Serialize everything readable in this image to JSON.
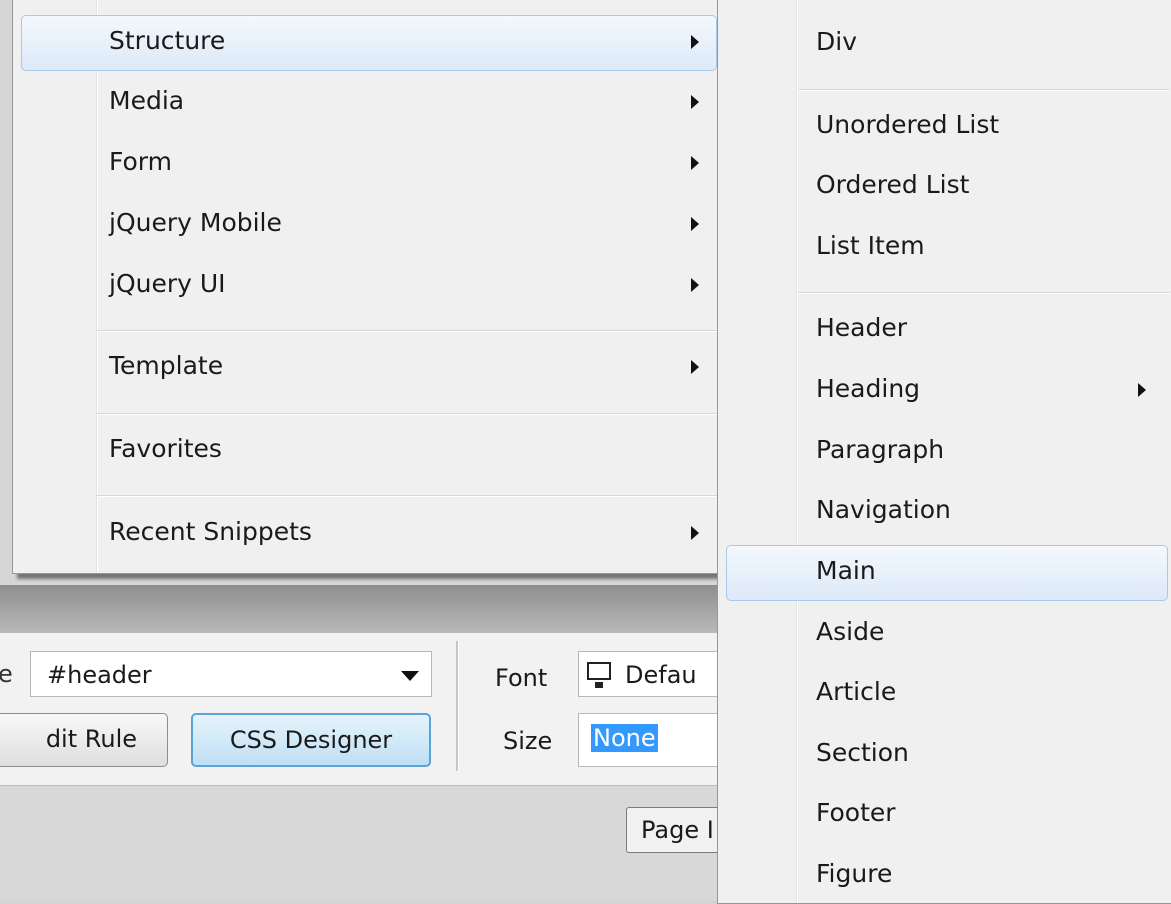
{
  "menu_primary": {
    "items": [
      {
        "label": "Structure",
        "submenu": true,
        "highlighted": true
      },
      {
        "label": "Media",
        "submenu": true
      },
      {
        "label": "Form",
        "submenu": true
      },
      {
        "label": "jQuery Mobile",
        "submenu": true
      },
      {
        "label": "jQuery UI",
        "submenu": true
      },
      {
        "label": "Template",
        "submenu": true
      },
      {
        "label": "Favorites",
        "submenu": false
      },
      {
        "label": "Recent Snippets",
        "submenu": true
      }
    ]
  },
  "menu_structure": {
    "items": [
      {
        "label": "Div"
      },
      {
        "label": "Unordered List"
      },
      {
        "label": "Ordered List"
      },
      {
        "label": "List Item"
      },
      {
        "label": "Header"
      },
      {
        "label": "Heading",
        "submenu": true
      },
      {
        "label": "Paragraph"
      },
      {
        "label": "Navigation"
      },
      {
        "label": "Main",
        "highlighted": true
      },
      {
        "label": "Aside"
      },
      {
        "label": "Article"
      },
      {
        "label": "Section"
      },
      {
        "label": "Footer"
      },
      {
        "label": "Figure"
      }
    ]
  },
  "properties": {
    "rule_label_fragment": "e",
    "rule_value": "#header",
    "edit_rule_label": "dit Rule",
    "css_designer_label": "CSS Designer",
    "font_label": "Font",
    "font_value": "Defau",
    "size_label": "Size",
    "size_value": "None",
    "page_button_label": "Page I"
  },
  "colors": {
    "menu_bg": "#f0f0f0",
    "highlight_border": "#a8c8ec",
    "selection": "#3399ff",
    "css_designer_button": "#bfdff5"
  }
}
